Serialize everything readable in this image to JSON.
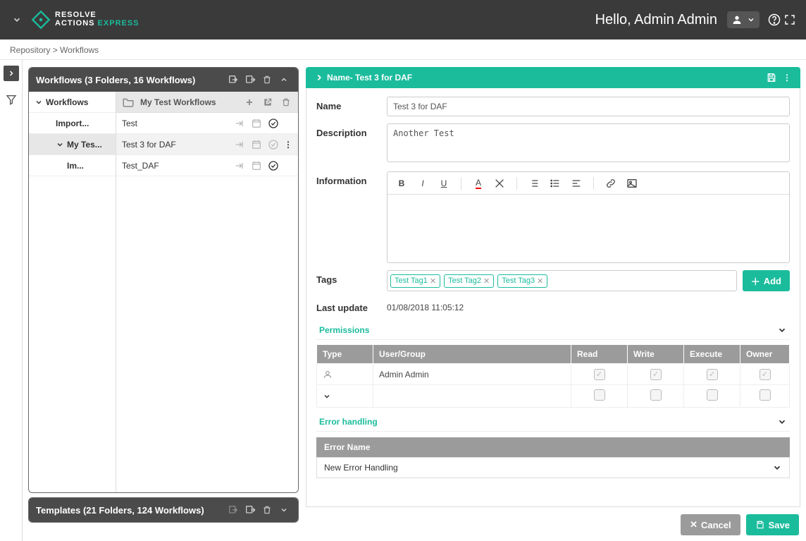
{
  "header": {
    "brand_line1": "RESOLVE",
    "brand_line2a": "ACTIONS",
    "brand_line2b": " EXPRESS",
    "greeting": "Hello, Admin Admin"
  },
  "breadcrumb": "Repository > Workflows",
  "panels": {
    "workflows_title": "Workflows (3 Folders, 16 Workflows)",
    "templates_title": "Templates (21 Folders, 124 Workflows)"
  },
  "tree": {
    "root": "Workflows",
    "items": [
      "Import...",
      "My Tes...",
      "Im..."
    ]
  },
  "list": {
    "folder": "My Test Workflows",
    "rows": [
      "Test",
      "Test 3 for DAF",
      "Test_DAF"
    ]
  },
  "detail": {
    "title": "Name- Test 3 for DAF",
    "labels": {
      "name": "Name",
      "description": "Description",
      "information": "Information",
      "tags": "Tags",
      "last_update": "Last update",
      "permissions": "Permissions",
      "error_handling": "Error handling"
    },
    "name_value": "Test 3 for DAF",
    "description_value": "Another Test",
    "tags": [
      "Test Tag1",
      "Test Tag2",
      "Test Tag3"
    ],
    "add_label": "Add",
    "last_update_value": "01/08/2018 11:05:12",
    "perm_headers": {
      "type": "Type",
      "user": "User/Group",
      "read": "Read",
      "write": "Write",
      "execute": "Execute",
      "owner": "Owner"
    },
    "perm_row_user": "Admin Admin",
    "error_name_header": "Error Name",
    "error_row": "New Error Handling"
  },
  "buttons": {
    "cancel": "Cancel",
    "save": "Save"
  }
}
